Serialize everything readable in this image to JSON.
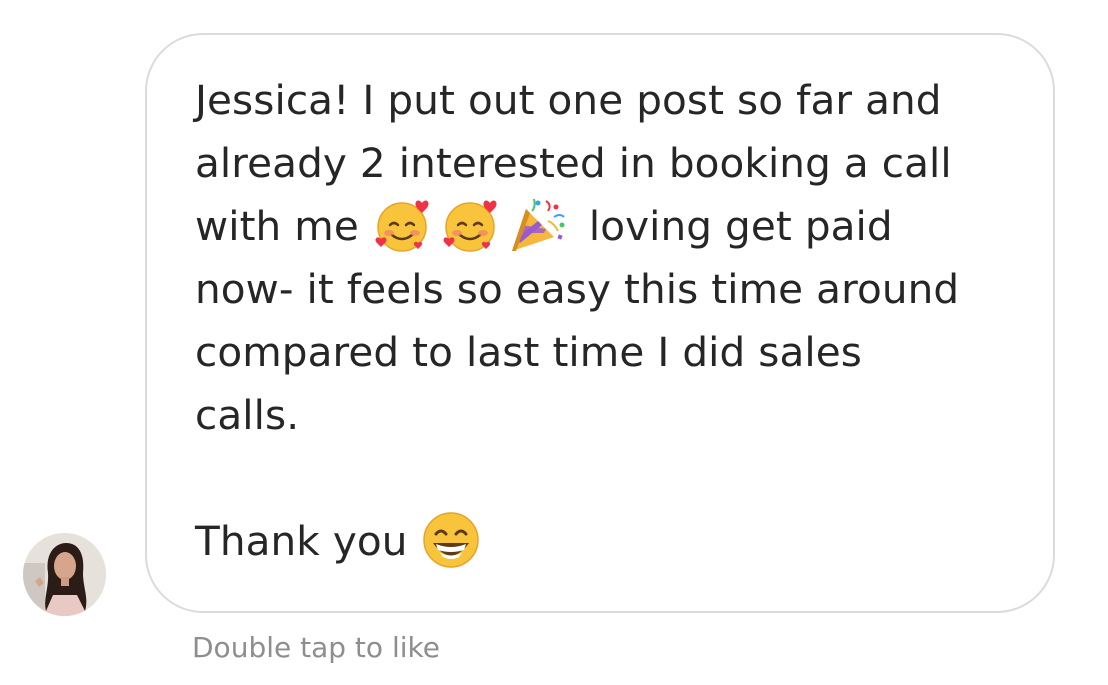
{
  "conversation": {
    "avatar_icon": "profile-photo",
    "message": {
      "lines": [
        "Jessica! I put out one post so far and",
        "already 2 interested in booking a call",
        "with me",
        "loving get paid",
        "now- it feels so easy this time around",
        "compared to last time I did sales",
        "calls.",
        "Thank you"
      ],
      "emojis": [
        "smiling-face-with-hearts",
        "smiling-face-with-hearts",
        "party-popper",
        "grinning-face-with-smiling-eyes"
      ]
    },
    "like_hint": "Double tap to like"
  },
  "colors": {
    "text": "#262626",
    "bubble_border": "#dbdbdb",
    "hint_text": "#8e8e8e",
    "background": "#ffffff"
  }
}
